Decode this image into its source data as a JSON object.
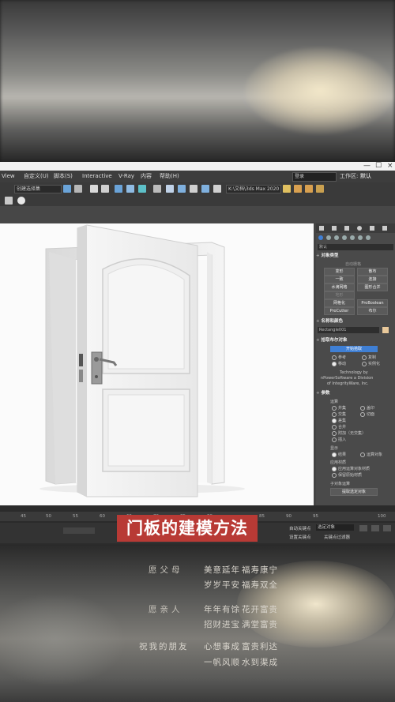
{
  "menu": {
    "items": [
      "View",
      "自定义(U)",
      "脚本(S)",
      "Interactive",
      "V-Ray",
      "内容",
      "帮助(H)"
    ],
    "search_label": "登录",
    "workspace_label": "工作区:",
    "workspace_value": "默认"
  },
  "toolbar": {
    "selection_set": "创建选择集",
    "path_value": "K:\\文档\\3ds Max 2020"
  },
  "panel": {
    "selection_field": "默认",
    "object_type_section": "对象类型",
    "auto_grid": "自动栅格",
    "buttons": [
      "变形",
      "散布",
      "一致",
      "连接",
      "水滴网格",
      "图形合并",
      "地形",
      "网格化",
      "ProBoolean",
      "ProCutter",
      "布尔"
    ],
    "name_color_section": "名称和颜色",
    "object_name": "Rectangle001",
    "pick_bool_section": "拾取布尔对象",
    "start_pick_button": "开始拾取",
    "radio_ref": "参考",
    "radio_copy": "复制",
    "radio_move": "移动",
    "radio_instance": "实例化",
    "credit_1": "Technology by",
    "credit_2": "nPowerSoftware a Division",
    "credit_3": "of IntegrityWare, Inc.",
    "params_section": "参数",
    "ops_label": "运算",
    "op_union": "并集",
    "op_merge": "合并",
    "op_intersect": "交集",
    "op_attach": "附加（无交集）",
    "op_subtract": "差集",
    "op_insert": "插入",
    "op_imprint": "盖印",
    "op_cut": "切面",
    "display_label": "显示",
    "display_result": "结果",
    "display_ops": "运算对象",
    "apply_material": "应用材质",
    "mat_apply_ops": "应用运算对象材质",
    "mat_keep": "保留原始材质",
    "sub_ops_label": "子对象运算",
    "extract_button": "提取选定对象"
  },
  "timeline": {
    "ruler_labels": [
      "45",
      "50",
      "55",
      "60",
      "65",
      "70",
      "75",
      "80",
      "85",
      "90",
      "95",
      "100"
    ],
    "auto_key": "自动关键点",
    "selected_obj": "选定对象",
    "set_key": "设置关键点",
    "key_filter": "关键点过滤器"
  },
  "caption": "门板的建模方法",
  "blessings": [
    {
      "who": "愿父母",
      "l1": "美意延年",
      "l2": "福寿康宁",
      "l3": "岁岁平安",
      "l4": "福寿双全"
    },
    {
      "who": "愿亲人",
      "l1": "年年有馀",
      "l2": "花开富贵",
      "l3": "招财进宝",
      "l4": "满堂富贵"
    },
    {
      "who": "祝我的朋友",
      "l1": "心想事成",
      "l2": "富贵利达",
      "l3": "一帆风顺",
      "l4": "水到渠成"
    }
  ],
  "colors": {
    "caption_bg": "#b83a35",
    "accent_blue": "#3f7fd4",
    "object_color_swatch": "#e8c89a"
  }
}
